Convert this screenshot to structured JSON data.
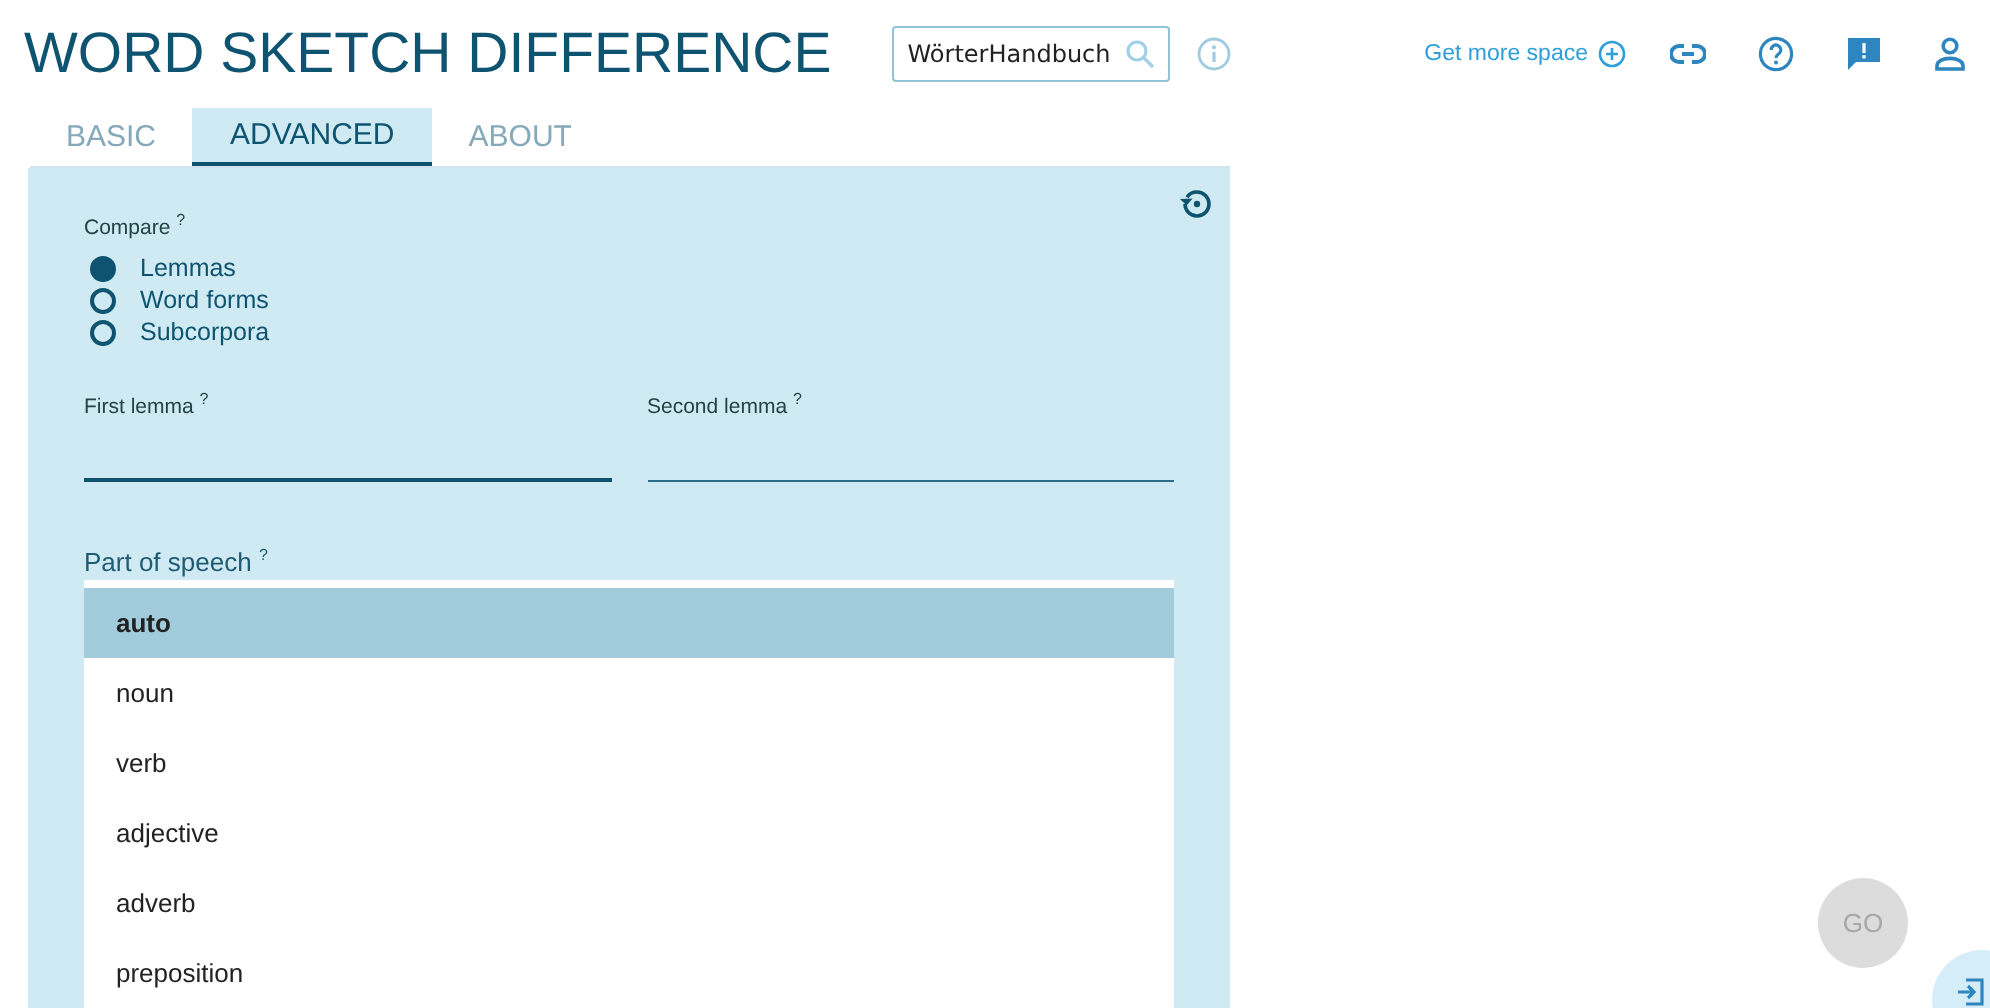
{
  "app": {
    "title": "WORD SKETCH DIFFERENCE"
  },
  "search": {
    "value": "WörterHandbuch"
  },
  "toolbar": {
    "get_more_space": "Get more space"
  },
  "tabs": [
    {
      "label": "BASIC",
      "selected": false
    },
    {
      "label": "ADVANCED",
      "selected": true
    },
    {
      "label": "ABOUT",
      "selected": false
    }
  ],
  "compare": {
    "label": "Compare $^{?}$",
    "options": [
      {
        "label": "Lemmas",
        "selected": true
      },
      {
        "label": "Word forms",
        "selected": false
      },
      {
        "label": "Subcorpora",
        "selected": false
      }
    ]
  },
  "fields": [
    {
      "label": "First lemma $^{?}$",
      "focused": true
    },
    {
      "label": "Second lemma $^{?}$",
      "focused": false
    }
  ],
  "part_of_speech": {
    "label": "Part of speech $^{?}$",
    "options": [
      {
        "label": "auto",
        "selected": true
      },
      {
        "label": "noun",
        "selected": false
      },
      {
        "label": "verb",
        "selected": false
      },
      {
        "label": "adjective",
        "selected": false
      },
      {
        "label": "adverb",
        "selected": false
      },
      {
        "label": "preposition",
        "selected": false
      }
    ]
  },
  "go_button": {
    "label": "GO",
    "disabled": true
  }
}
